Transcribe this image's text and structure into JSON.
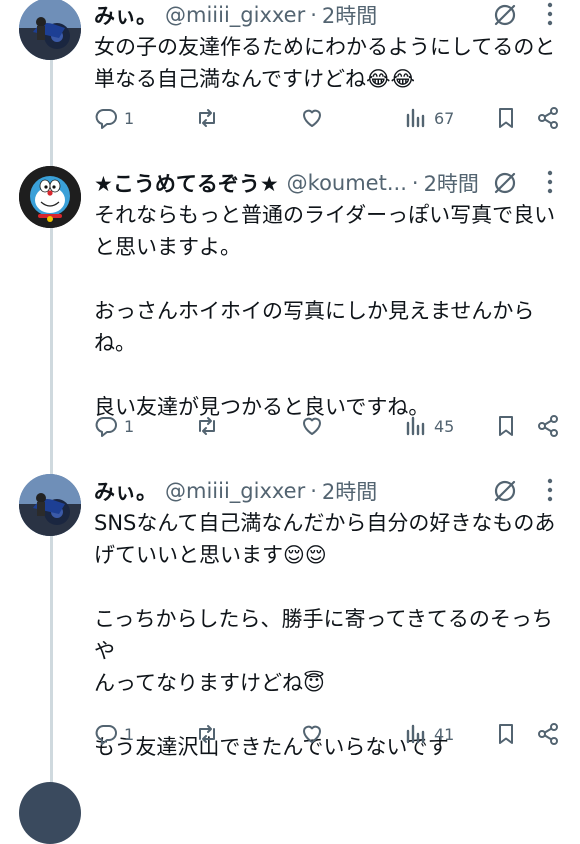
{
  "tweets": [
    {
      "name": "みぃ。",
      "handle": "@miiii_gixxer",
      "time": "2時間",
      "lines": [
        "女の子の友達作るためにわかるようにしてるのと",
        "単なる自己満なんですけどね😂😂"
      ],
      "replies": "1",
      "views": "67"
    },
    {
      "name": "★こうめてるぞう★",
      "handle": "@koumet...",
      "time": "2時間",
      "lines": [
        "それならもっと普通のライダーっぽい写真で良い",
        "と思いますよ。",
        "",
        "おっさんホイホイの写真にしか見えませんから",
        "ね。",
        "",
        "良い友達が見つかると良いですね。"
      ],
      "replies": "1",
      "views": "45"
    },
    {
      "name": "みぃ。",
      "handle": "@miiii_gixxer",
      "time": "2時間",
      "lines": [
        "SNSなんて自己満なんだから自分の好きなものあ",
        "げていいと思います😌😌",
        "",
        "こっちからしたら、勝手に寄ってきてるのそっちや",
        "んってなりますけどね😇",
        "",
        "もう友達沢山できたんでいらないです"
      ],
      "replies": "1",
      "views": "41"
    }
  ],
  "icons": {
    "reply": "reply-icon",
    "retweet": "retweet-icon",
    "like": "heart-icon",
    "views": "views-chart-icon",
    "bookmark": "bookmark-icon",
    "share": "share-icon",
    "grok": "grok-icon",
    "more": "more-dots-icon"
  },
  "colors": {
    "text": "#0f1419",
    "secondary": "#536471",
    "thread_line": "#cfd9de"
  }
}
